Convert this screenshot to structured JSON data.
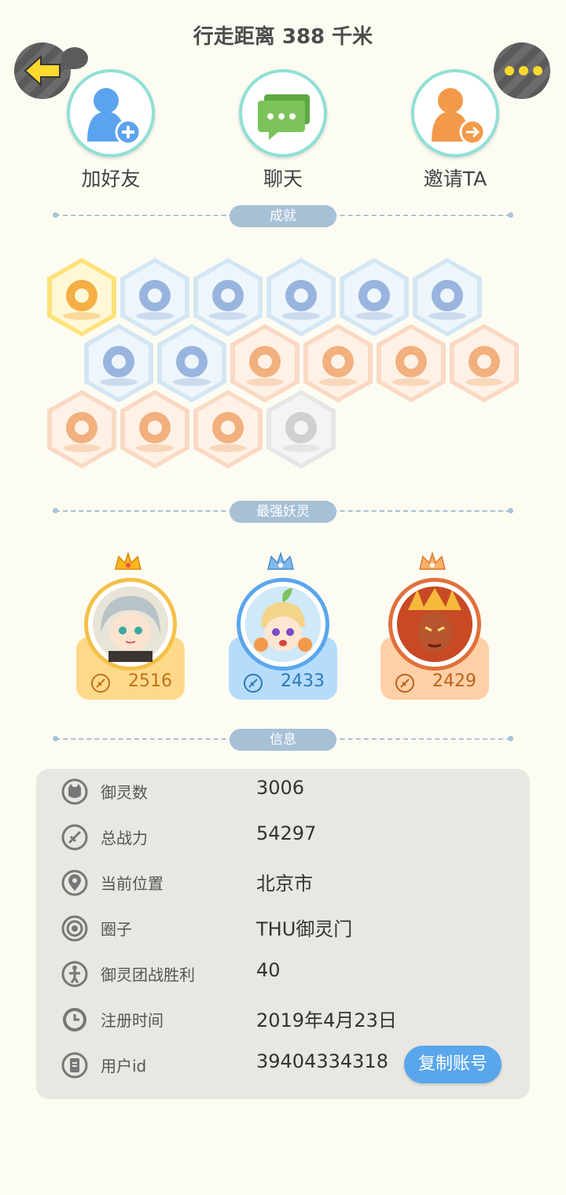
{
  "header": {
    "title": "行走距离 388 千米"
  },
  "actions": [
    {
      "label": "加好友",
      "icon": "add-friend-icon",
      "color": "#5ba3ee"
    },
    {
      "label": "聊天",
      "icon": "chat-icon",
      "color": "#7cc35a"
    },
    {
      "label": "邀请TA",
      "icon": "invite-icon",
      "color": "#f39a4a"
    }
  ],
  "sections": {
    "achievements": "成就",
    "strongest": "最强妖灵",
    "info": "信息"
  },
  "achievements": [
    {
      "icon": "cat-mask-badge-icon",
      "tier": "gold"
    },
    {
      "icon": "sneaker-badge-icon",
      "tier": "blue"
    },
    {
      "icon": "portal-badge-icon",
      "tier": "blue"
    },
    {
      "icon": "orb-badge-icon",
      "tier": "blue"
    },
    {
      "icon": "crystal-badge-icon",
      "tier": "blue"
    },
    {
      "icon": "yin-yang-wave-badge-icon",
      "tier": "blue"
    },
    {
      "icon": "cat-spirit-badge-icon",
      "tier": "blue"
    },
    {
      "icon": "yin-yang-book-badge-icon",
      "tier": "blue"
    },
    {
      "icon": "moon-sun-badge-icon",
      "tier": "orange"
    },
    {
      "icon": "fox-spirit-badge-icon",
      "tier": "orange"
    },
    {
      "icon": "cat-cart-badge-icon",
      "tier": "orange"
    },
    {
      "icon": "koi-badge-icon",
      "tier": "orange"
    },
    {
      "icon": "scroll-badge-icon",
      "tier": "orange"
    },
    {
      "icon": "beast-badge-icon",
      "tier": "orange"
    },
    {
      "icon": "twin-spirits-badge-icon",
      "tier": "orange"
    },
    {
      "icon": "wolf-book-badge-icon",
      "tier": "gray"
    }
  ],
  "strongest_spirits": [
    {
      "power": "2516",
      "tier": "gold"
    },
    {
      "power": "2433",
      "tier": "blue"
    },
    {
      "power": "2429",
      "tier": "orange"
    }
  ],
  "info": [
    {
      "label": "御灵数",
      "value": "3006",
      "icon": "spirit-count-icon"
    },
    {
      "label": "总战力",
      "value": "54297",
      "icon": "sword-icon"
    },
    {
      "label": "当前位置",
      "value": "北京市",
      "icon": "location-pin-icon"
    },
    {
      "label": "圈子",
      "value": "THU御灵门",
      "icon": "circle-target-icon"
    },
    {
      "label": "御灵团战胜利",
      "value": "40",
      "icon": "trophy-icon"
    },
    {
      "label": "注册时间",
      "value": "2019年4月23日",
      "icon": "clock-icon"
    },
    {
      "label": "用户id",
      "value": "39404334318",
      "icon": "id-card-icon"
    }
  ],
  "copy_button": "复制账号",
  "colors": {
    "gold": "#ffd98a",
    "blue": "#b5dcfb",
    "orange": "#ffcfa6",
    "gold_text": "#c0711b",
    "blue_text": "#2d79b6",
    "orange_text": "#b9631e"
  }
}
